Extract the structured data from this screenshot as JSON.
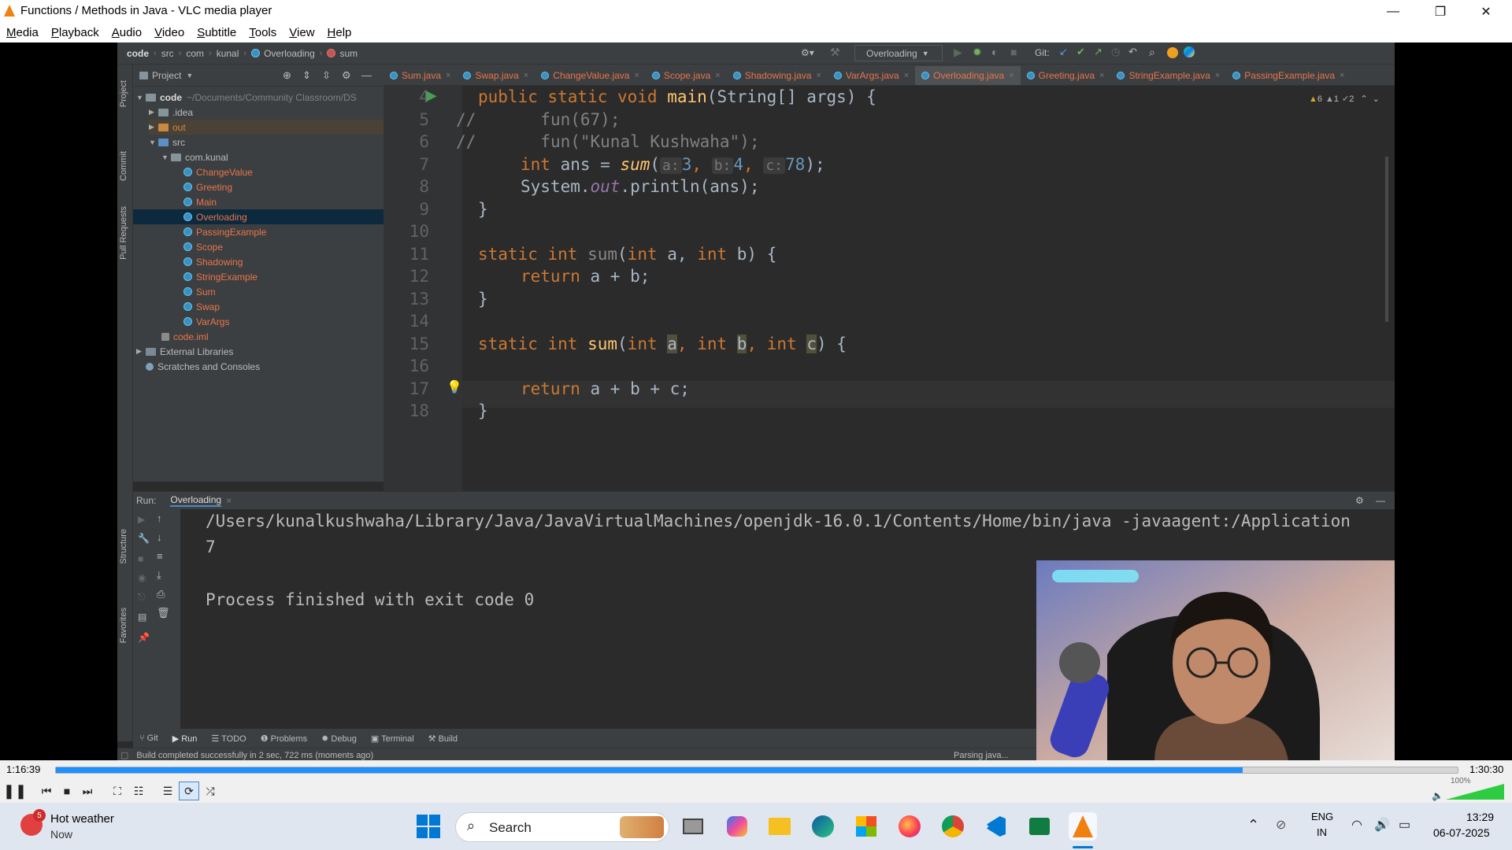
{
  "window": {
    "title": "Functions / Methods in Java - VLC media player",
    "minimize": "—",
    "maximize": "❐",
    "close": "✕"
  },
  "menu": [
    "Media",
    "Playback",
    "Audio",
    "Video",
    "Subtitle",
    "Tools",
    "View",
    "Help"
  ],
  "ide": {
    "breadcrumb": [
      "code",
      "src",
      "com",
      "kunal",
      "Overloading",
      "sum"
    ],
    "run_config": "Overloading",
    "git_label": "Git:",
    "project_label": "Project",
    "warnings": {
      "warn": "6",
      "weak": "1",
      "typo": "2"
    },
    "left_strip": [
      "Project",
      "Commit",
      "Pull Requests",
      "Structure",
      "Favorites"
    ],
    "tree": {
      "root": "code",
      "root_path": "~/Documents/Community Classroom/DS",
      "idea": ".idea",
      "out": "out",
      "src": "src",
      "pkg": "com.kunal",
      "classes": [
        "ChangeValue",
        "Greeting",
        "Main",
        "Overloading",
        "PassingExample",
        "Scope",
        "Shadowing",
        "StringExample",
        "Sum",
        "Swap",
        "VarArgs"
      ],
      "iml": "code.iml",
      "external": "External Libraries",
      "scratches": "Scratches and Consoles"
    },
    "tabs": [
      "Sum.java",
      "Swap.java",
      "ChangeValue.java",
      "Scope.java",
      "Shadowing.java",
      "VarArgs.java",
      "Overloading.java",
      "Greeting.java",
      "StringExample.java",
      "PassingExample.java"
    ],
    "line_numbers": [
      "4",
      "5",
      "6",
      "7",
      "8",
      "9",
      "10",
      "11",
      "12",
      "13",
      "14",
      "15",
      "16",
      "17",
      "18"
    ],
    "code": {
      "l4_a": "public static void ",
      "l4_fn": "main",
      "l4_b": "(String[] args) {",
      "l5_cm": "//",
      "l5": "fun(",
      "l5_num": "67",
      "l5_end": ");",
      "l6_cm": "//",
      "l6": "fun(",
      "l6_str": "\"Kunal Kushwaha\"",
      "l6_end": ");",
      "l7_kw": "int",
      "l7_a": " ans = ",
      "l7_fn": "sum",
      "l7_b": "(",
      "l7_h1": "a:",
      "l7_n1": "3",
      "l7_c": ", ",
      "l7_h2": "b:",
      "l7_n2": "4",
      "l7_d": ", ",
      "l7_h3": "c:",
      "l7_n3": "78",
      "l7_e": ");",
      "l8_a": "System.",
      "l8_it": "out",
      "l8_b": ".println(ans);",
      "brace": "}",
      "l11_kw": "static int ",
      "l11_fn": "sum",
      "l11_a": "(",
      "l11_k1": "int",
      "l11_b": " a, ",
      "l11_k2": "int",
      "l11_c": " b) {",
      "ret": "return",
      "l12": " a + b;",
      "l15_kw": "static int ",
      "l15_fn": "sum",
      "l15_a": "(",
      "l15_k1": "int ",
      "l15_v1": "a",
      "l15_b": ", ",
      "l15_k2": "int ",
      "l15_v2": "b",
      "l15_c": ", ",
      "l15_k3": "int ",
      "l15_v3": "c",
      "l15_d": ") {",
      "l16": " a + b + c;"
    },
    "run": {
      "label": "Run:",
      "tab": "Overloading",
      "cmd": "/Users/kunalkushwaha/Library/Java/JavaVirtualMachines/openjdk-16.0.1/Contents/Home/bin/java -javaagent:/Application",
      "output": "7",
      "exit": "Process finished with exit code 0"
    },
    "bottom_tabs": [
      "Git",
      "Run",
      "TODO",
      "Problems",
      "Debug",
      "Terminal",
      "Build"
    ],
    "status_left": "Build completed successfully in 2 sec, 722 ms (moments ago)",
    "status_right": "Parsing java..."
  },
  "player": {
    "elapsed": "1:16:39",
    "total": "1:30:30",
    "progress": 0.8466,
    "volume": "100%"
  },
  "taskbar": {
    "weather_title": "Hot weather",
    "weather_sub": "Now",
    "weather_badge": "5",
    "search": "Search",
    "lang1": "ENG",
    "lang2": "IN",
    "time": "13:29",
    "date": "06-07-2025"
  },
  "colors": {
    "ide_bg": "#2b2b2b",
    "keyword": "#cc7832",
    "method": "#ffc66d",
    "seek_fill": "#1e90ff",
    "taskbar": "#dfe6f0"
  }
}
